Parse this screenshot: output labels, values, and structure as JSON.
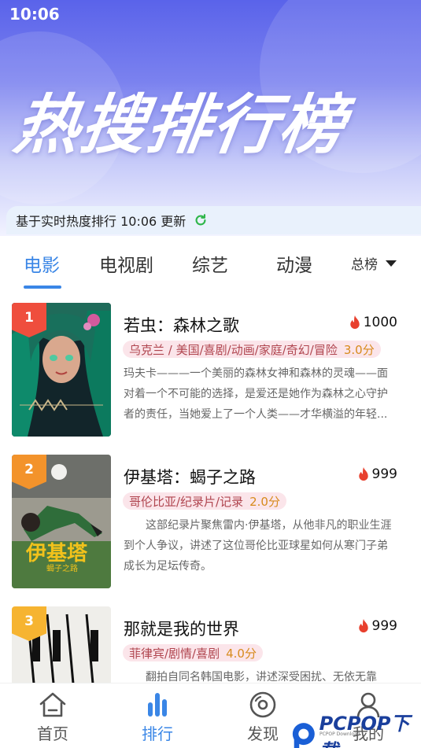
{
  "status_bar": {
    "time": "10:06"
  },
  "banner": {
    "title": "热搜排行榜"
  },
  "update": {
    "text": "基于实时热度排行 10:06 更新"
  },
  "tabs": [
    {
      "label": "电影",
      "active": true
    },
    {
      "label": "电视剧",
      "active": false
    },
    {
      "label": "综艺",
      "active": false
    },
    {
      "label": "动漫",
      "active": false
    }
  ],
  "rank_select": {
    "label": "总榜"
  },
  "items": [
    {
      "rank": "1",
      "title": "若虫：森林之歌",
      "heat": "1000",
      "genres": "乌克兰 / 美国/喜剧/动画/家庭/奇幻/冒险",
      "score": "3.0分",
      "desc": "玛夫卡———一个美丽的森林女神和森林的灵魂——面对着一个不可能的选择，是爱还是她作为森林之心守护者的责任，当她爱上了一个人类——才华横溢的年轻..."
    },
    {
      "rank": "2",
      "title": "伊基塔：蝎子之路",
      "heat": "999",
      "genres": "哥伦比亚/纪录片/记录",
      "score": "2.0分",
      "desc": "这部纪录片聚焦雷内·伊基塔，从他非凡的职业生涯到个人争议，讲述了这位哥伦比亚球星如何从寒门子弟成长为足坛传奇。",
      "poster_text": "伊基塔",
      "poster_sub": "蝎子之路"
    },
    {
      "rank": "3",
      "title": "那就是我的世界",
      "heat": "999",
      "genres": "菲律宾/剧情/喜剧",
      "score": "4.0分",
      "desc": "翻拍自同名韩国电影，讲述深受困扰、无依无靠"
    }
  ],
  "bottom_nav": [
    {
      "label": "首页",
      "icon": "home-icon",
      "active": false
    },
    {
      "label": "排行",
      "icon": "ranking-icon",
      "active": true
    },
    {
      "label": "发现",
      "icon": "discover-icon",
      "active": false
    },
    {
      "label": "我的",
      "icon": "user-icon",
      "active": false
    }
  ],
  "watermark": {
    "text": "PCPOP下载",
    "sub": "PCPOP Download"
  },
  "colors": {
    "accent": "#3a86e6",
    "rank1": "#ef4e3d",
    "rank2": "#f3932b",
    "rank3": "#f6b431",
    "fire": "#e8402e",
    "score": "#d78a1c"
  }
}
